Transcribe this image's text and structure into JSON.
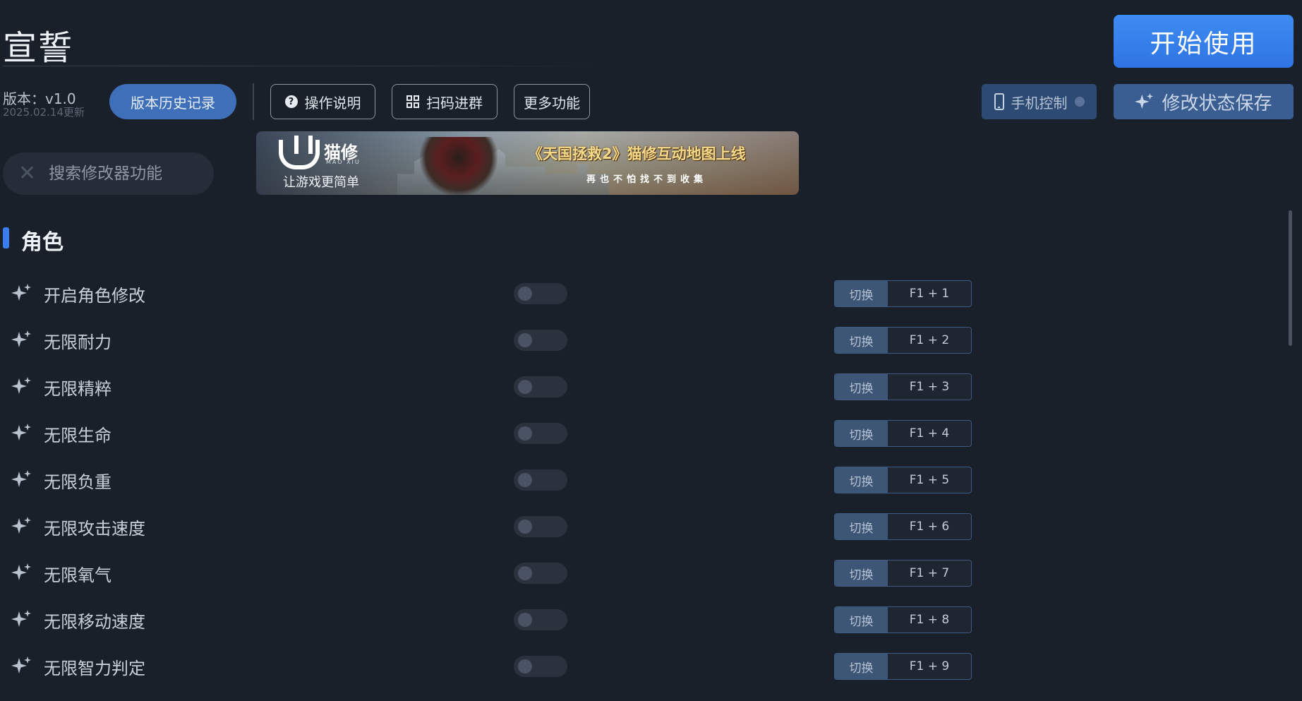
{
  "header": {
    "game_title": "宣誓",
    "start_button": "开始使用"
  },
  "version": {
    "label": "版本：v1.0",
    "date": "2025.02.14更新",
    "history_button": "版本历史记录"
  },
  "toolbar": {
    "guide": "操作说明",
    "scan": "扫码进群",
    "more": "更多功能",
    "phone_control": "手机控制",
    "save_state": "修改状态保存"
  },
  "search": {
    "placeholder": "搜索修改器功能"
  },
  "banner": {
    "brand": "猫修",
    "brand_sub": "MAO XIU",
    "slogan": "让游戏更简单",
    "headline": "《天国拯救2》猫修互动地图上线",
    "subline": "再也不怕找不到收集"
  },
  "section": {
    "title": "角色"
  },
  "features": [
    {
      "label": "开启角色修改",
      "action": "切换",
      "keys": "F1 + 1"
    },
    {
      "label": "无限耐力",
      "action": "切换",
      "keys": "F1 + 2"
    },
    {
      "label": "无限精粹",
      "action": "切换",
      "keys": "F1 + 3"
    },
    {
      "label": "无限生命",
      "action": "切换",
      "keys": "F1 + 4"
    },
    {
      "label": "无限负重",
      "action": "切换",
      "keys": "F1 + 5"
    },
    {
      "label": "无限攻击速度",
      "action": "切换",
      "keys": "F1 + 6"
    },
    {
      "label": "无限氧气",
      "action": "切换",
      "keys": "F1 + 7"
    },
    {
      "label": "无限移动速度",
      "action": "切换",
      "keys": "F1 + 8"
    },
    {
      "label": "无限智力判定",
      "action": "切换",
      "keys": "F1 + 9"
    }
  ],
  "colors": {
    "accent": "#3b7cf0",
    "background": "#1a2029"
  }
}
